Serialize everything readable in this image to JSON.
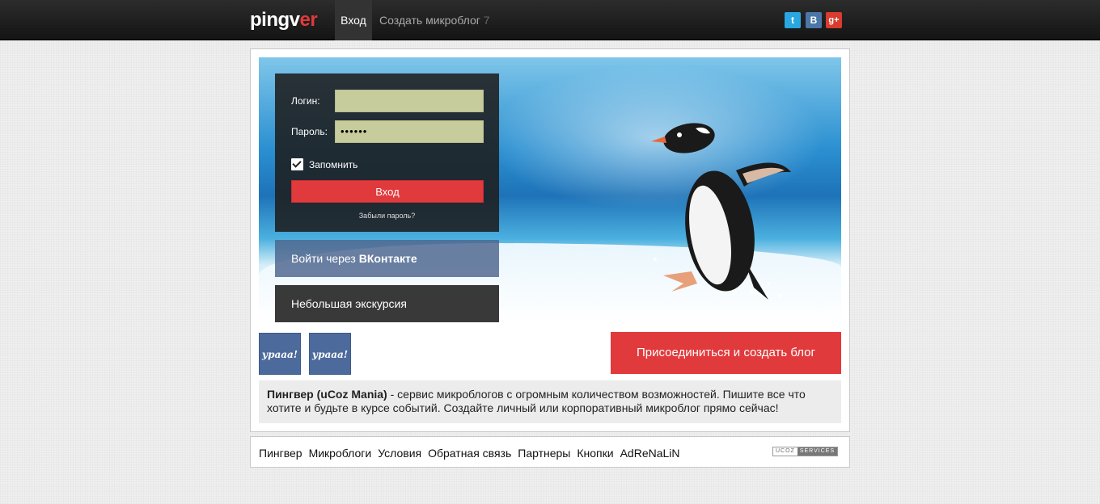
{
  "header": {
    "logo_main": "pingv",
    "logo_accent": "er",
    "nav_login": "Вход",
    "nav_create": "Создать микроблог",
    "nav_create_count": "7",
    "social": {
      "twitter": "t",
      "vk": "B",
      "gplus": "g+"
    }
  },
  "login_form": {
    "login_label": "Логин:",
    "login_value": "",
    "password_label": "Пароль:",
    "password_value": "••••••",
    "remember_label": "Запомнить",
    "submit_label": "Вход",
    "forgot_label": "Забыли пароль?"
  },
  "vk_login": {
    "prefix": "Войти через ",
    "brand": "ВКонтакте"
  },
  "tour_label": "Небольшая экскурсия",
  "avatars": [
    "ураaa!",
    "ураaa!"
  ],
  "join_label": "Присоединиться и создать блог",
  "description": {
    "title": "Пингвер (uCoz Mania)",
    "text": " - сервис микроблогов с огромным количеством возможностей. Пишите все что хотите и будьте в курсе событий. Создайте личный или корпоративный микроблог прямо сейчас!"
  },
  "footer": {
    "links": [
      "Пингвер",
      "Микроблоги",
      "Условия",
      "Обратная связь",
      "Партнеры",
      "Кнопки",
      "AdReNaLiN"
    ],
    "badge_left": "UCOZ",
    "badge_right": "SERVICES"
  },
  "colors": {
    "accent": "#e13a3d",
    "vk": "#4b77a8",
    "topbar": "#1e1e1e"
  }
}
